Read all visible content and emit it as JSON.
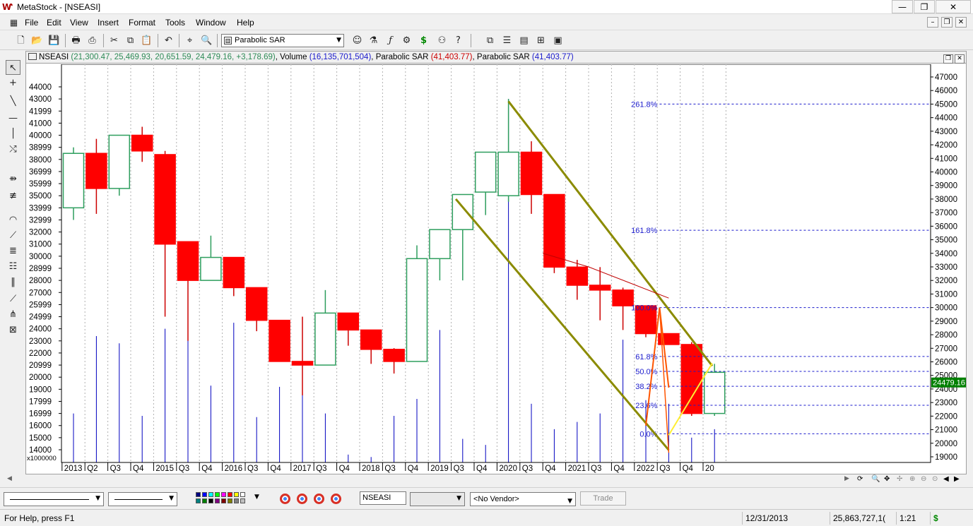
{
  "window": {
    "title": "MetaStock - [NSEASI]",
    "app_icon": "Ⱳ",
    "min": "—",
    "restore": "❐",
    "close": "✕"
  },
  "menu": {
    "items": [
      "File",
      "Edit",
      "View",
      "Insert",
      "Format",
      "Tools",
      "Window",
      "Help"
    ],
    "mdi_min": "–",
    "mdi_restore": "❐",
    "mdi_close": "✕"
  },
  "toolbar": {
    "icons": [
      "new-icon",
      "open-icon",
      "save-icon",
      "print-icon",
      "print-preview-icon",
      "cut-icon",
      "copy-icon",
      "paste-icon",
      "undo-icon",
      "crosshair-icon",
      "zoom-icon",
      "explorer-icon",
      "system-tester-icon",
      "formula-icon",
      "dollar-icon",
      "binoculars-icon",
      "help-icon",
      "layout-icon"
    ],
    "indicator_select": "Parabolic SAR"
  },
  "chart_header": {
    "symbol": "NSEASI",
    "ohlc": "(21,300.47, 25,469.93, 20,651.59, 24,479.16, +3,178.69)",
    "volume_label": "Volume",
    "volume_value": "(16,135,701,504)",
    "sar1_label": "Parabolic SAR",
    "sar1_value": "(41,403.77)",
    "sar2_label": "Parabolic SAR",
    "sar2_value": "(41,403.77)",
    "restore_btn": "❐",
    "close_btn": "✕"
  },
  "bottom_toolbar": {
    "symbol": "NSEASI",
    "vendor": "<No Vendor>",
    "trade": "Trade",
    "colors": [
      "#000080",
      "#0000ff",
      "#00ffff",
      "#00ff00",
      "#ff00ff",
      "#ff0000",
      "#ffff00",
      "#ffffff",
      "#008080",
      "#008000",
      "#000000",
      "#800080",
      "#800000",
      "#808000",
      "#808080",
      "#c0c0c0"
    ]
  },
  "statusbar": {
    "help": "For Help, press F1",
    "date": "12/31/2013",
    "value": "25,863,727,1(",
    "ratio": "1:21",
    "dollar": "$"
  },
  "chart_data": {
    "type": "candlestick",
    "colors": {
      "up": "#2e9e5e",
      "down": "#ff0000",
      "volume": "#0000c0",
      "channel": "#8b8b00",
      "fib": "#1a1acc",
      "trend": "#c00000",
      "yellow": "#ffee33",
      "last_price_bg": "#008000"
    },
    "left_axis": {
      "min": 14000,
      "max": 44000,
      "ticks": [
        14000,
        15000,
        16000,
        16999,
        17999,
        19000,
        20000,
        20999,
        22000,
        23000,
        24000,
        24999,
        25999,
        27000,
        28000,
        28999,
        30000,
        31000,
        32000,
        32999,
        33999,
        35000,
        35999,
        36999,
        38000,
        38999,
        40000,
        41000,
        41999,
        43000,
        44000
      ],
      "unit_label": "x1000000"
    },
    "right_axis": {
      "min": 19000,
      "max": 47000,
      "step": 1000,
      "last_price": "24479.16"
    },
    "x_labels": [
      "2013",
      "Q2",
      "Q3",
      "Q4",
      "2015",
      "Q3",
      "Q4",
      "2016",
      "Q3",
      "Q4",
      "2017",
      "Q3",
      "Q4",
      "2018",
      "Q3",
      "Q4",
      "2019",
      "Q3",
      "Q4",
      "2020",
      "Q3",
      "Q4",
      "2021",
      "Q3",
      "Q4",
      "2022",
      "Q3",
      "Q4",
      "20"
    ],
    "candles": [
      {
        "o": 34000,
        "h": 38999,
        "l": 32999,
        "c": 38500
      },
      {
        "o": 38500,
        "h": 39700,
        "l": 33500,
        "c": 35600
      },
      {
        "o": 35600,
        "h": 40000,
        "l": 35000,
        "c": 40000
      },
      {
        "o": 40000,
        "h": 40700,
        "l": 37800,
        "c": 38700
      },
      {
        "o": 38400,
        "h": 38700,
        "l": 25000,
        "c": 31000
      },
      {
        "o": 31200,
        "h": 31200,
        "l": 23000,
        "c": 28000
      },
      {
        "o": 28000,
        "h": 31700,
        "l": 28000,
        "c": 29900
      },
      {
        "o": 29900,
        "h": 29900,
        "l": 26700,
        "c": 27400
      },
      {
        "o": 27400,
        "h": 27400,
        "l": 23800,
        "c": 24700
      },
      {
        "o": 24700,
        "h": 24700,
        "l": 22000,
        "c": 21300
      },
      {
        "o": 21300,
        "h": 25000,
        "l": 18500,
        "c": 21000
      },
      {
        "o": 21000,
        "h": 27200,
        "l": 21000,
        "c": 25300
      },
      {
        "o": 25300,
        "h": 25300,
        "l": 22600,
        "c": 23900
      },
      {
        "o": 23900,
        "h": 23900,
        "l": 21100,
        "c": 22300
      },
      {
        "o": 22300,
        "h": 22400,
        "l": 20300,
        "c": 21300
      },
      {
        "o": 21300,
        "h": 30900,
        "l": 21300,
        "c": 29800
      },
      {
        "o": 29800,
        "h": 31500,
        "l": 28000,
        "c": 32200
      },
      {
        "o": 32200,
        "h": 33800,
        "l": 28000,
        "c": 35100
      },
      {
        "o": 35300,
        "h": 37200,
        "l": 33400,
        "c": 38600
      },
      {
        "o": 35000,
        "h": 43000,
        "l": 34500,
        "c": 38600
      },
      {
        "o": 38600,
        "h": 39500,
        "l": 33500,
        "c": 35100
      },
      {
        "o": 35100,
        "h": 35100,
        "l": 28600,
        "c": 29100
      },
      {
        "o": 29100,
        "h": 29700,
        "l": 26400,
        "c": 27600
      },
      {
        "o": 27600,
        "h": 29100,
        "l": 24700,
        "c": 27200
      },
      {
        "o": 27200,
        "h": 27400,
        "l": 23900,
        "c": 25900
      },
      {
        "o": 25900,
        "h": 25900,
        "l": 23300,
        "c": 23600
      },
      {
        "o": 23600,
        "h": 23600,
        "l": 22700,
        "c": 22700
      },
      {
        "o": 22700,
        "h": 22900,
        "l": 16800,
        "c": 17000
      },
      {
        "o": 17000,
        "h": 21100,
        "l": 16800,
        "c": 20400
      }
    ],
    "volume": [
      17000,
      23400,
      22800,
      16800,
      24000,
      26700,
      19300,
      24500,
      16700,
      19200,
      22300,
      17000,
      13600,
      13400,
      16800,
      18200,
      23900,
      14900,
      14400,
      43000,
      17800,
      15700,
      16300,
      17000,
      23100,
      18100,
      17800,
      15000,
      15700
    ],
    "fibonacci": [
      {
        "label": "261.8%",
        "price": 45000
      },
      {
        "label": "161.8%",
        "price": 35700
      },
      {
        "label": "100.0%",
        "price": 30000
      },
      {
        "label": "61.8%",
        "price": 26400
      },
      {
        "label": "50.0%",
        "price": 25300
      },
      {
        "label": "38.2%",
        "price": 24200
      },
      {
        "label": "23.6%",
        "price": 22800
      },
      {
        "label": "0.0%",
        "price": 20700
      }
    ]
  }
}
